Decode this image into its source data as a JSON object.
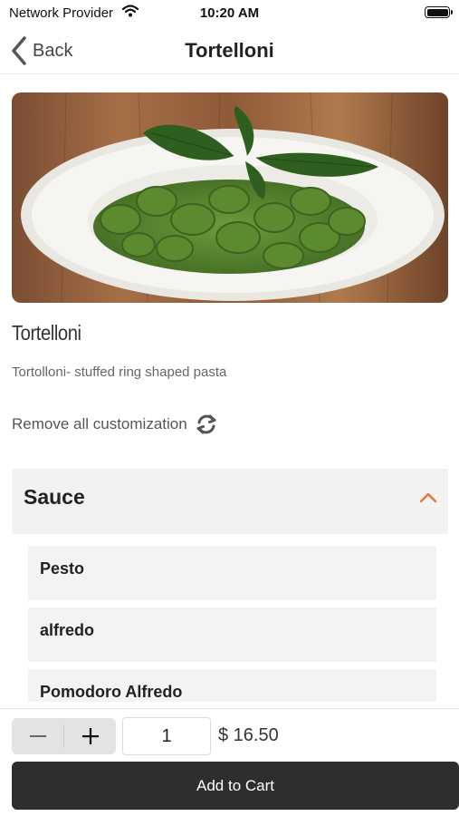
{
  "status_bar": {
    "carrier": "Network Provider",
    "time": "10:20 AM",
    "icons": [
      "wifi-icon",
      "battery-icon"
    ]
  },
  "nav": {
    "back_label": "Back",
    "title": "Tortelloni",
    "back_icon": "chevron-left-icon"
  },
  "item": {
    "name": "Tortelloni",
    "description": "Tortolloni- stuffed ring shaped pasta",
    "image_subject": "plate of tortelloni in pesto sauce with basil leaves on a wooden table"
  },
  "customization": {
    "remove_label": "Remove all customization",
    "remove_icon": "refresh-icon"
  },
  "sauce_section": {
    "title": "Sauce",
    "expanded_icon": "chevron-up-icon",
    "options": [
      {
        "label": "Pesto"
      },
      {
        "label": "alfredo"
      },
      {
        "label": "Pomodoro Alfredo"
      }
    ]
  },
  "footer": {
    "quantity": "1",
    "price": "$ 16.50",
    "add_to_cart_label": "Add to Cart",
    "minus_icon": "minus-icon",
    "plus_icon": "plus-icon"
  },
  "colors": {
    "accent": "#e8723a",
    "button_dark": "#2e2e2d",
    "panel_gray": "#f2f2f2"
  }
}
